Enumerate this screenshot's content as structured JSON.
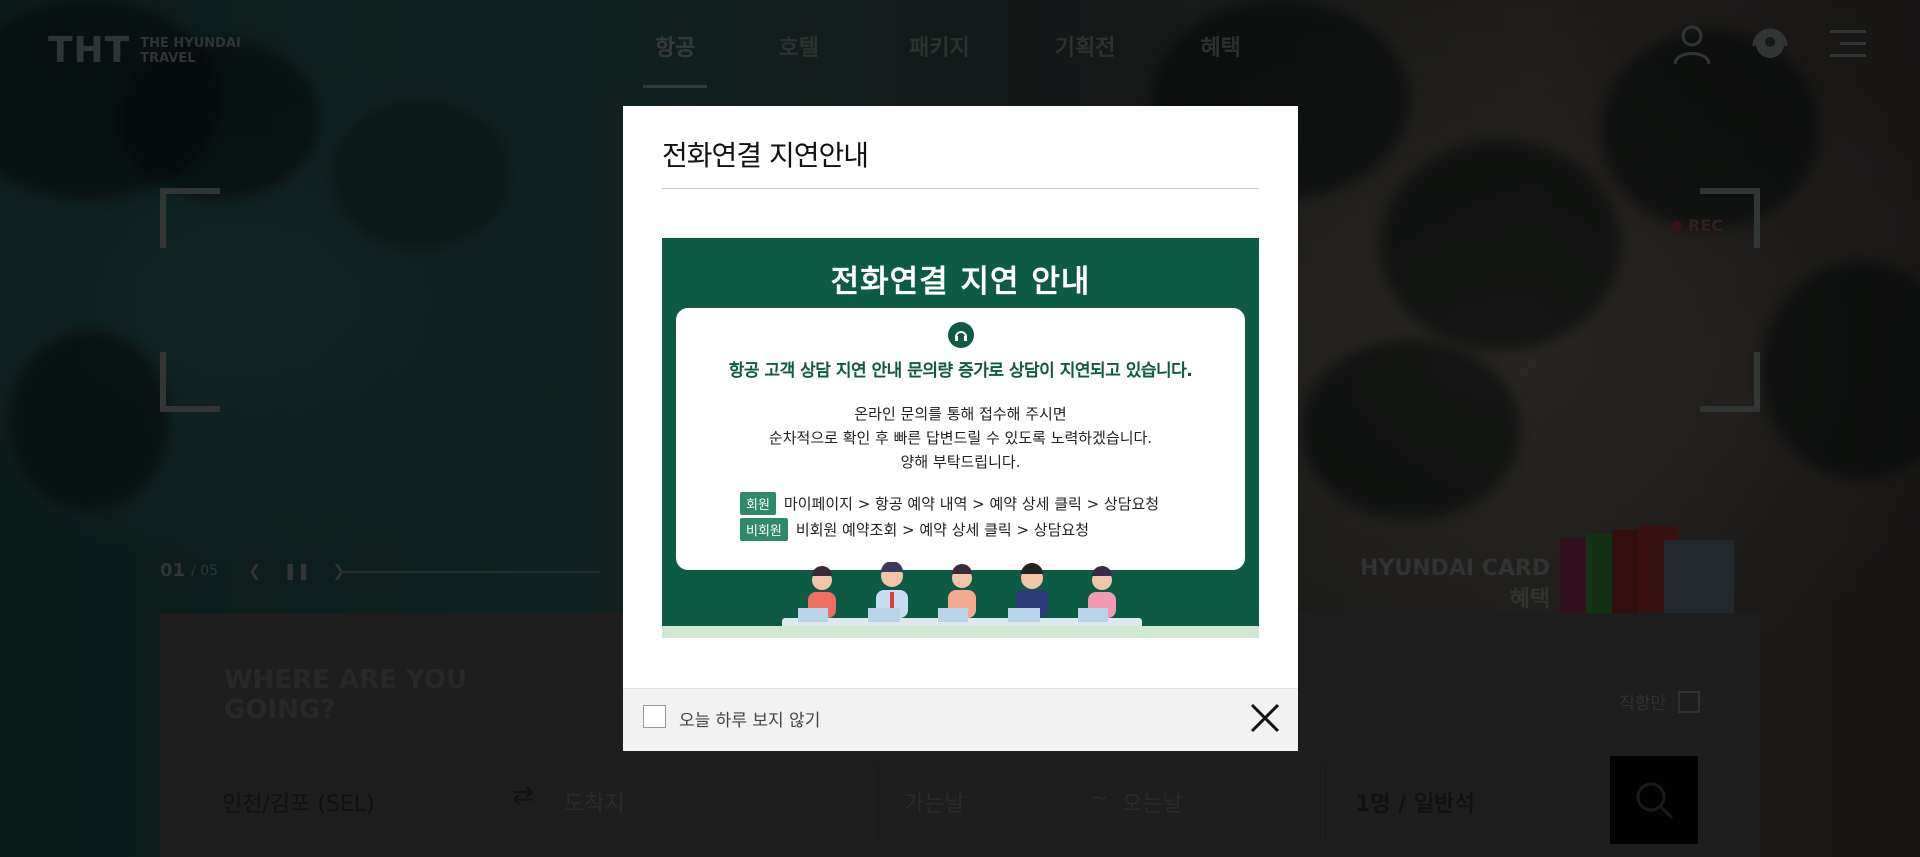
{
  "brand": {
    "logo_mark": "THT",
    "logo_line1": "THE HYUNDAI",
    "logo_line2": "TRAVEL"
  },
  "nav": [
    "항공",
    "호텔",
    "패키지",
    "기획전",
    "혜택"
  ],
  "nav_active": "항공",
  "header_icons": [
    "user-icon",
    "customer-service-icon",
    "menu-icon"
  ],
  "hero": {
    "rec_label": "REC",
    "slide_current": "01",
    "slide_total": "/ 05",
    "card_promo_line1": "HYUNDAI CARD",
    "card_promo_line2": "혜택"
  },
  "search": {
    "heading_line1": "WHERE ARE YOU",
    "heading_line2": "GOING?",
    "direct_label": "직항만",
    "origin": "인천/김포 (SEL)",
    "destination_placeholder": "도착지",
    "depart_placeholder": "가는날",
    "date_sep": "~",
    "return_placeholder": "오는날",
    "passengers": "1명 / 일반석"
  },
  "modal": {
    "title": "전화연결 지연안내",
    "notice_title": "전화연결 지연 안내",
    "notice_head": "항공 고객 상담 지연 안내  문의량 증가로 상담이 지연되고 있습니다.",
    "notice_body": [
      "온라인 문의를 통해 접수해 주시면",
      "순차적으로 확인 후 빠른 답변드릴 수 있도록 노력하겠습니다.",
      "양해 부탁드립니다."
    ],
    "routes": [
      {
        "tag": "회원",
        "path": "마이페이지 > 항공 예약 내역 > 예약 상세 클릭 > 상담요청"
      },
      {
        "tag": "비회원",
        "path": "비회원 예약조회 > 예약 상세 클릭 > 상담요청"
      }
    ],
    "dont_show_label": "오늘 하루 보지 않기"
  },
  "colors": {
    "notice_green": "#0d5a45",
    "tag_green": "#2f8a6c"
  }
}
